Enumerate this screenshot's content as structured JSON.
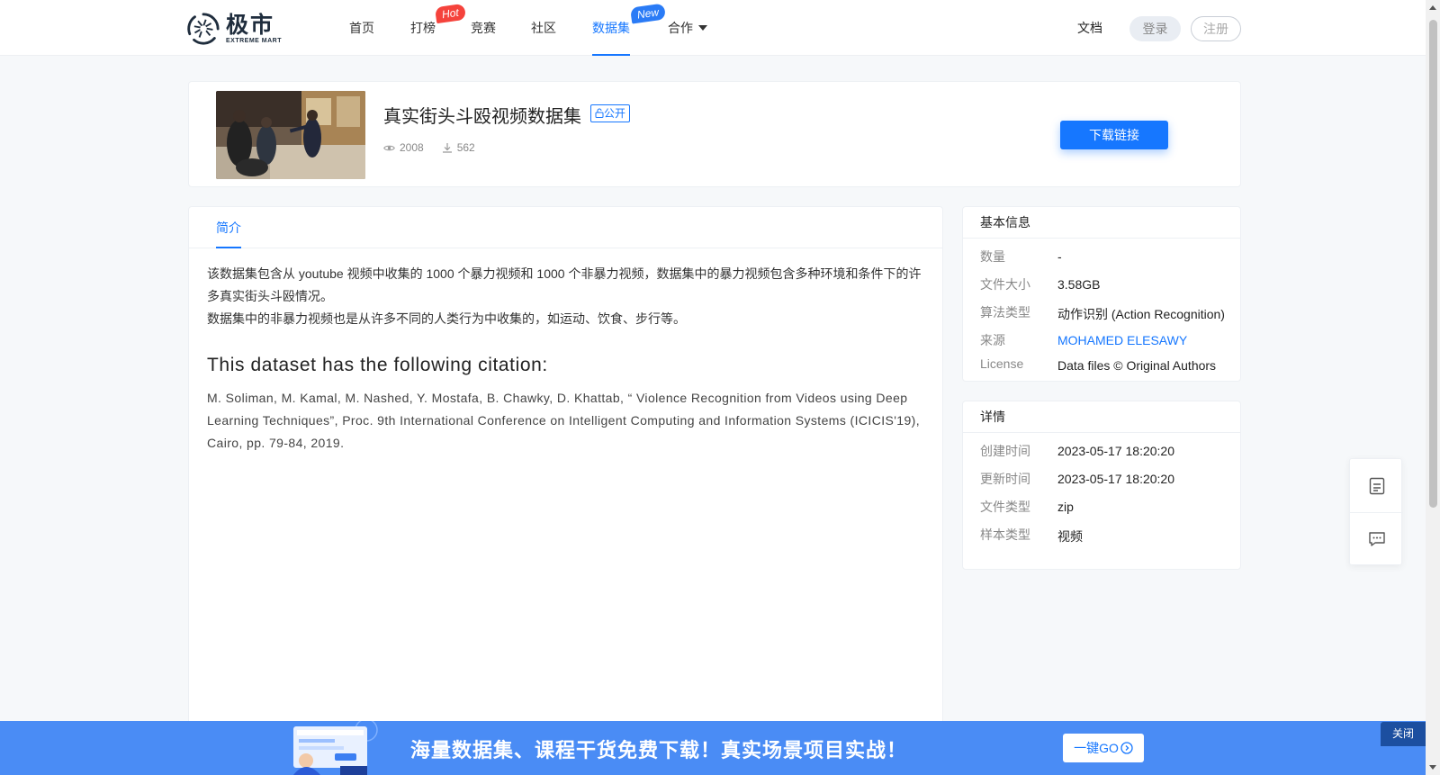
{
  "brand": {
    "name_cn": "极市",
    "name_en": "EXTREME MART"
  },
  "nav": {
    "items": [
      {
        "label": "首页"
      },
      {
        "label": "打榜",
        "badge": "Hot"
      },
      {
        "label": "竞赛"
      },
      {
        "label": "社区"
      },
      {
        "label": "数据集",
        "badge": "New",
        "active": true
      },
      {
        "label": "合作"
      }
    ],
    "docs": "文档",
    "login": "登录",
    "register": "注册"
  },
  "dataset": {
    "title": "真实街头斗殴视频数据集",
    "visibility": "公开",
    "views": "2008",
    "downloads": "562",
    "download_button": "下载链接"
  },
  "tabs": [
    {
      "label": "简介",
      "active": true
    }
  ],
  "intro": {
    "paragraph1": "该数据集包含从 youtube 视频中收集的 1000 个暴力视频和 1000 个非暴力视频，数据集中的暴力视频包含多种环境和条件下的许多真实街头斗殴情况。",
    "paragraph2": "数据集中的非暴力视频也是从许多不同的人类行为中收集的，如运动、饮食、步行等。",
    "citation_heading": "This dataset has the following citation:",
    "citation": "M. Soliman, M. Kamal, M. Nashed, Y. Mostafa, B. Chawky, D. Khattab, “ Violence Recognition from Videos using Deep Learning Techniques”, Proc. 9th International Conference on Intelligent Computing and Information Systems (ICICIS'19), Cairo, pp. 79-84, 2019."
  },
  "basic_info": {
    "title": "基本信息",
    "rows": [
      {
        "key": "数量",
        "value": "-"
      },
      {
        "key": "文件大小",
        "value": "3.58GB"
      },
      {
        "key": "算法类型",
        "value": "动作识别 (Action Recognition)"
      },
      {
        "key": "来源",
        "value": "MOHAMED ELESAWY"
      },
      {
        "key": "License",
        "value": "Data files © Original Authors"
      }
    ]
  },
  "details": {
    "title": "详情",
    "rows": [
      {
        "key": "创建时间",
        "value": "2023-05-17 18:20:20"
      },
      {
        "key": "更新时间",
        "value": "2023-05-17 18:20:20"
      },
      {
        "key": "文件类型",
        "value": "zip"
      },
      {
        "key": "样本类型",
        "value": "视频"
      }
    ]
  },
  "banner": {
    "text": "海量数据集、课程干货免费下载！真实场景项目实战！",
    "go_button": "一键GO",
    "close": "关闭"
  },
  "colors": {
    "accent": "#1677ff",
    "hot": "#f5433c",
    "banner": "#4a8cf5"
  }
}
